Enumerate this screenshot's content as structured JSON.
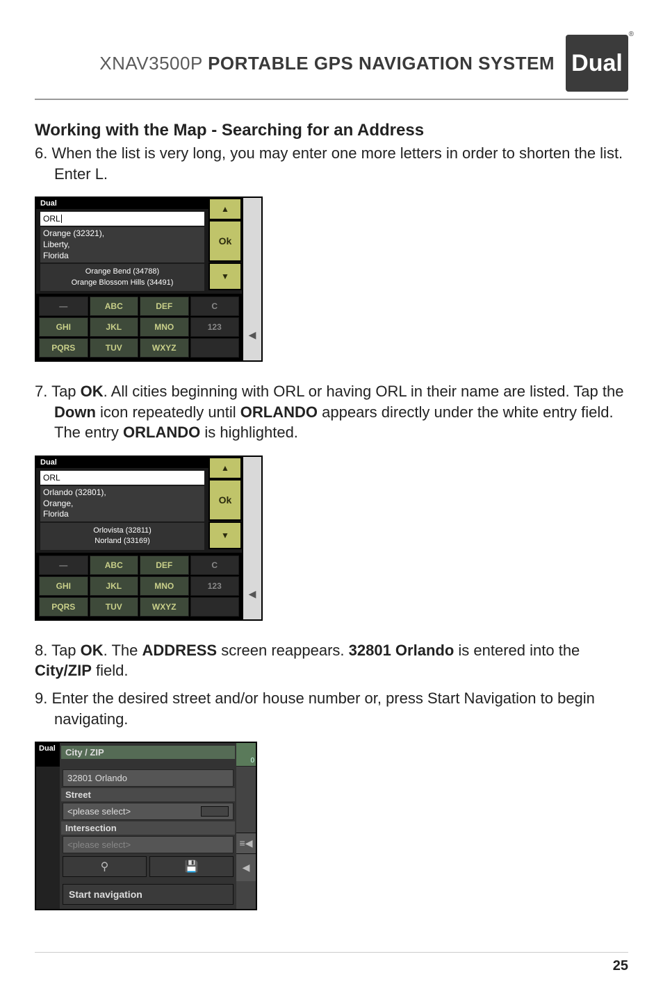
{
  "header": {
    "product_model": "XNAV3500P",
    "product_tagline": "PORTABLE GPS NAVIGATION SYSTEM",
    "logo_text": "Dual",
    "logo_registered": "®"
  },
  "section_title": "Working with the Map - Searching for an Address",
  "steps": {
    "s6a": "6. When the list is very long, you may enter one more letters in order to shorten the list.",
    "s6b": "Enter L.",
    "s7a": "7. Tap ",
    "s7b": ". All cities beginning with ORL or having ORL in their name are listed. Tap the ",
    "s7c": " icon repeatedly until ",
    "s7d": " appears directly under the white entry field.",
    "s7e": "The entry ",
    "s7f": " is highlighted.",
    "s8a": "8. Tap ",
    "s8b": ". The ",
    "s8c": " screen reappears. ",
    "s8d": " is entered into the ",
    "s8e": " field.",
    "s9": "9. Enter the desired street and/or house number or, press Start Navigation to begin",
    "s9b": "navigating.",
    "ok": "OK",
    "down": "Down",
    "orlando": "ORLANDO",
    "address": "ADDRESS",
    "zip_orlando": "32801 Orlando",
    "city_zip": "City/ZIP"
  },
  "shot1": {
    "brand": "Dual",
    "input": "ORL",
    "selected_line1": "Orange (32321),",
    "selected_line2": "Liberty,",
    "selected_line3": "Florida",
    "list_item1": "Orange Bend (34788)",
    "list_item2": "Orange Blossom Hills (34491)",
    "ok": "Ok",
    "keys": {
      "space": "—",
      "abc": "ABC",
      "def": "DEF",
      "c": "C",
      "ghi": "GHI",
      "jkl": "JKL",
      "mno": "MNO",
      "num": "123",
      "pqrs": "PQRS",
      "tuv": "TUV",
      "wxyz": "WXYZ"
    }
  },
  "shot2": {
    "brand": "Dual",
    "input": "ORL",
    "selected_line1": "Orlando (32801),",
    "selected_line2": "Orange,",
    "selected_line3": "Florida",
    "list_item1": "Orlovista (32811)",
    "list_item2": "Norland (33169)",
    "ok": "Ok"
  },
  "shot3": {
    "brand": "Dual",
    "city_label": "City / ZIP",
    "city_value": "32801 Orlando",
    "street_label": "Street",
    "street_value": "<please select>",
    "inter_label": "Intersection",
    "inter_value": "<please select>",
    "start": "Start navigation",
    "sat_count": "0"
  },
  "page_number": "25"
}
